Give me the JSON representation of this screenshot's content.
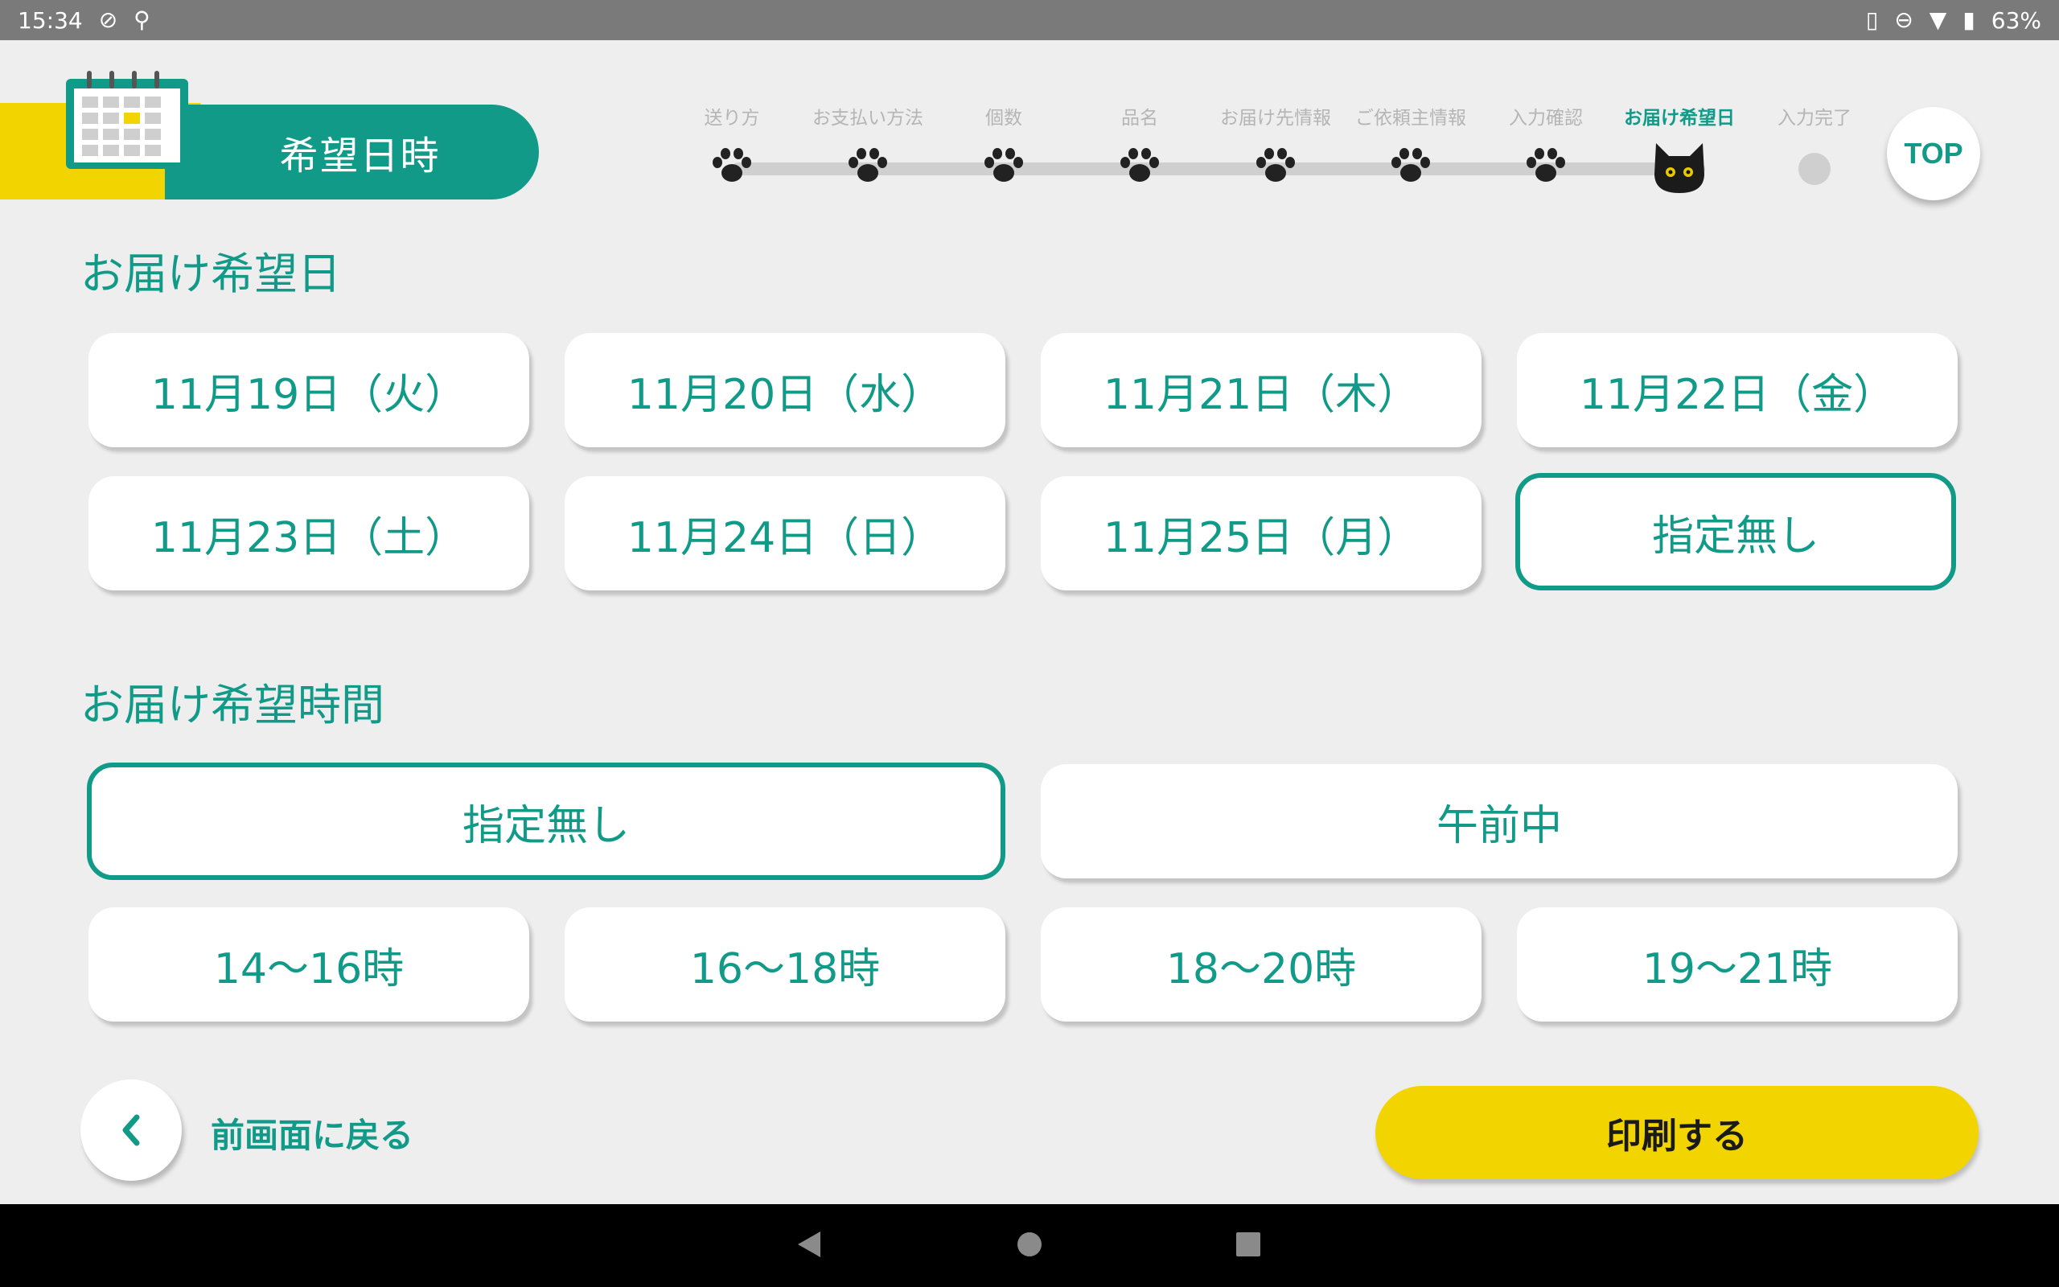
{
  "status_bar": {
    "time": "15:34",
    "battery": "63%"
  },
  "header": {
    "title": "希望日時",
    "top_button": "TOP"
  },
  "progress": {
    "steps": [
      {
        "label": "送り方",
        "state": "done"
      },
      {
        "label": "お支払い方法",
        "state": "done"
      },
      {
        "label": "個数",
        "state": "done"
      },
      {
        "label": "品名",
        "state": "done"
      },
      {
        "label": "お届け先情報",
        "state": "done"
      },
      {
        "label": "ご依頼主情報",
        "state": "done"
      },
      {
        "label": "入力確認",
        "state": "done"
      },
      {
        "label": "お届け希望日",
        "state": "current"
      },
      {
        "label": "入力完了",
        "state": "pending"
      }
    ]
  },
  "delivery_date": {
    "title": "お届け希望日",
    "options": [
      "11月19日（火）",
      "11月20日（水）",
      "11月21日（木）",
      "11月22日（金）",
      "11月23日（土）",
      "11月24日（日）",
      "11月25日（月）",
      "指定無し"
    ],
    "selected": "指定無し"
  },
  "delivery_time": {
    "title": "お届け希望時間",
    "options": [
      "指定無し",
      "午前中",
      "14〜16時",
      "16〜18時",
      "18〜20時",
      "19〜21時"
    ],
    "selected": "指定無し"
  },
  "footer": {
    "back_label": "前画面に戻る",
    "print_label": "印刷する"
  },
  "colors": {
    "primary": "#129a89",
    "accent": "#f2d500",
    "background": "#eeeeee"
  }
}
